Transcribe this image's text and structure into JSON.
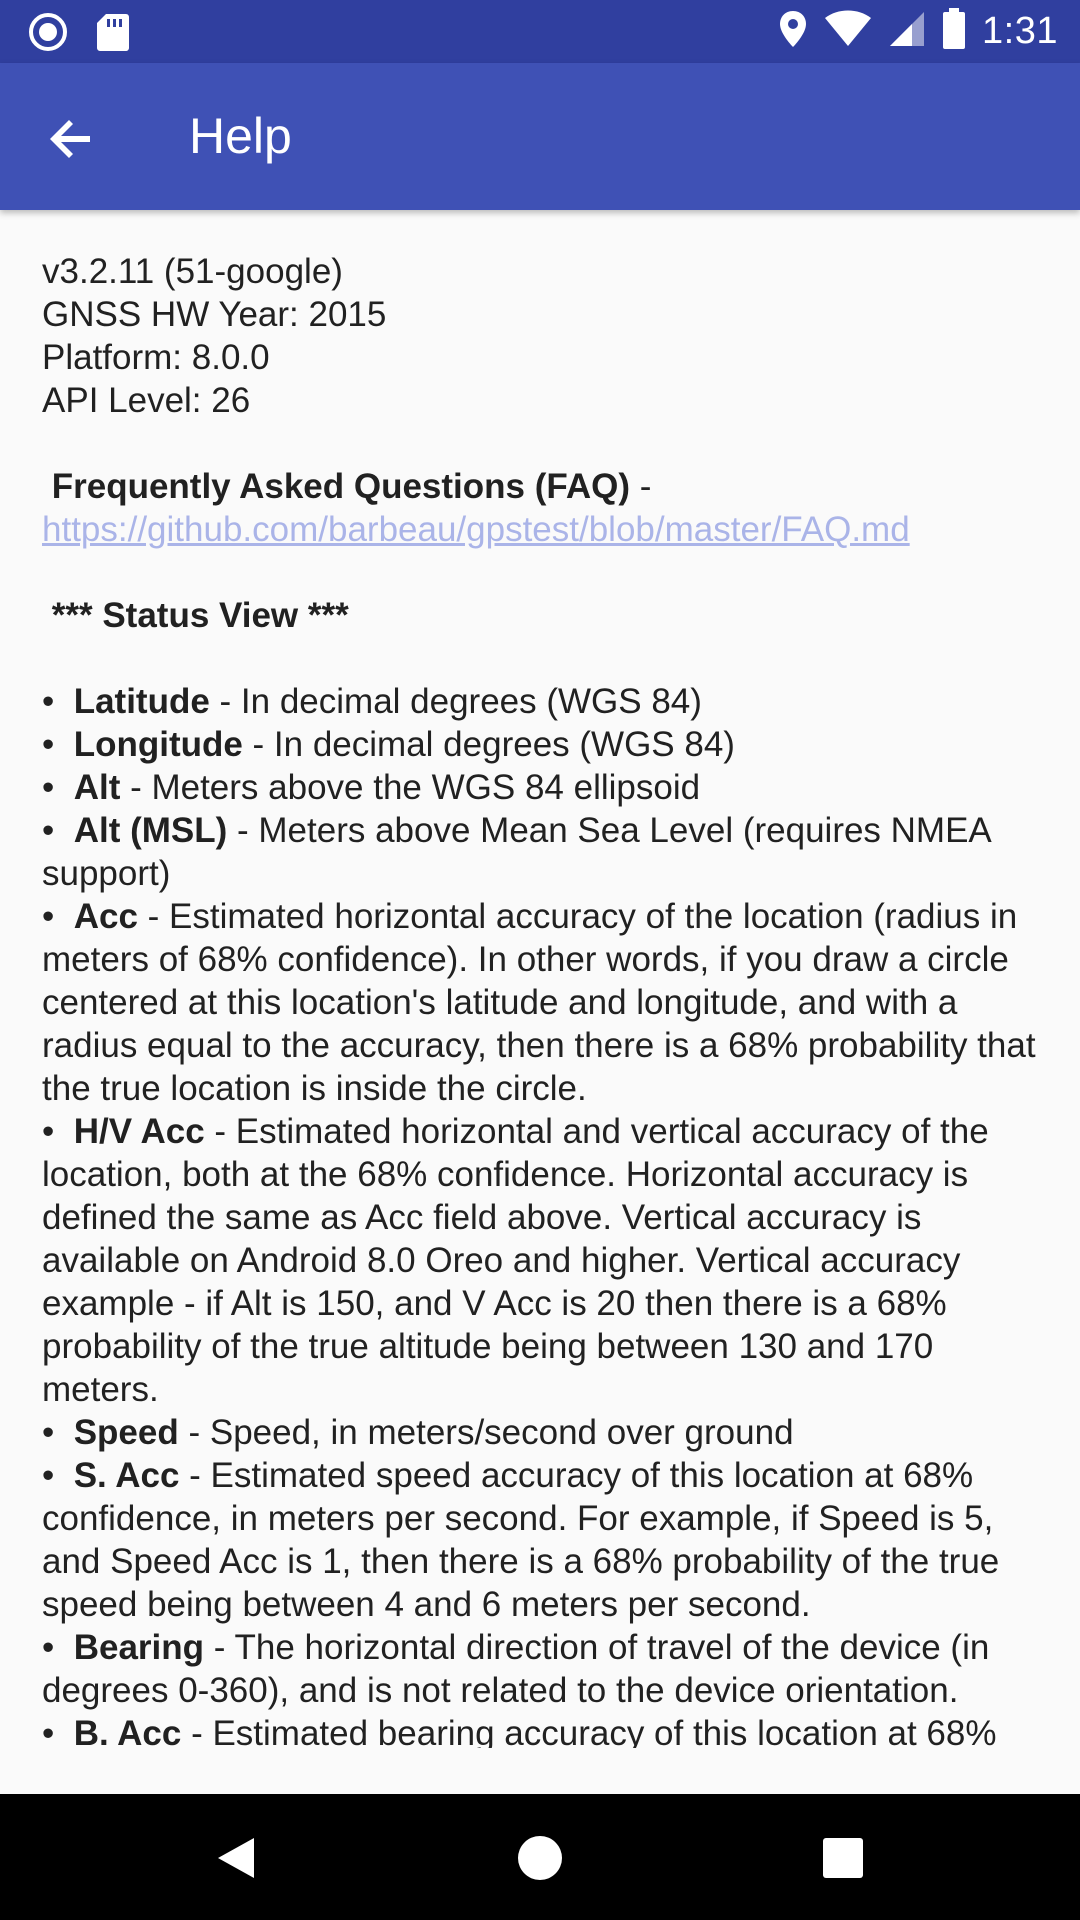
{
  "status_bar": {
    "time": "1:31",
    "icons": [
      "record-icon",
      "sd-card-icon",
      "location-icon",
      "wifi-icon",
      "signal-icon",
      "battery-icon"
    ]
  },
  "app_bar": {
    "title": "Help",
    "back_icon": "arrow-back-icon",
    "color": "#3f51b5"
  },
  "content": {
    "version": "v3.2.11 (51-google)",
    "gnss_year": "GNSS HW Year: 2015",
    "platform": "Platform: 8.0.0",
    "api_level": "API Level: 26",
    "faq_heading": "Frequently Asked Questions (FAQ)",
    "faq_sep": " -",
    "faq_link": "https://github.com/barbeau/gpstest/blob/master/FAQ.md",
    "status_heading": "*** Status View ***",
    "items": [
      {
        "term": "Latitude",
        "desc": " - In decimal degrees (WGS 84)"
      },
      {
        "term": "Longitude",
        "desc": " - In decimal degrees (WGS 84)"
      },
      {
        "term": "Alt",
        "desc": " - Meters above the WGS 84 ellipsoid"
      },
      {
        "term": "Alt (MSL)",
        "desc": " - Meters above Mean Sea Level (requires NMEA support)"
      },
      {
        "term": "Acc",
        "desc": " - Estimated horizontal accuracy of the location (radius in meters of 68% confidence). In other words, if you draw a circle centered at this location's latitude and longitude, and with a radius equal to the accuracy, then there is a 68% probability that the true location is inside the circle."
      },
      {
        "term": "H/V Acc",
        "desc": " - Estimated horizontal and vertical accuracy of the location, both at the 68% confidence. Horizontal accuracy is defined the same as Acc field above. Vertical accuracy is available on Android 8.0 Oreo and higher. Vertical accuracy example - if Alt is 150, and V Acc is 20 then there is a 68% probability of the true altitude being between 130 and 170 meters."
      },
      {
        "term": "Speed",
        "desc": " - Speed, in meters/second over ground"
      },
      {
        "term": "S. Acc",
        "desc": " - Estimated speed accuracy of this location at 68% confidence, in meters per second. For example, if Speed is 5, and Speed Acc is 1, then there is a 68% probability of the true speed being between 4 and 6 meters per second."
      },
      {
        "term": "Bearing",
        "desc": " - The horizontal direction of travel of the device (in degrees 0-360), and is not related to the device orientation."
      },
      {
        "term": "B. Acc",
        "desc": " - Estimated bearing accuracy of this location at 68%"
      }
    ]
  },
  "nav_bar": {
    "icons": [
      "nav-back-icon",
      "nav-home-icon",
      "nav-recents-icon"
    ]
  }
}
